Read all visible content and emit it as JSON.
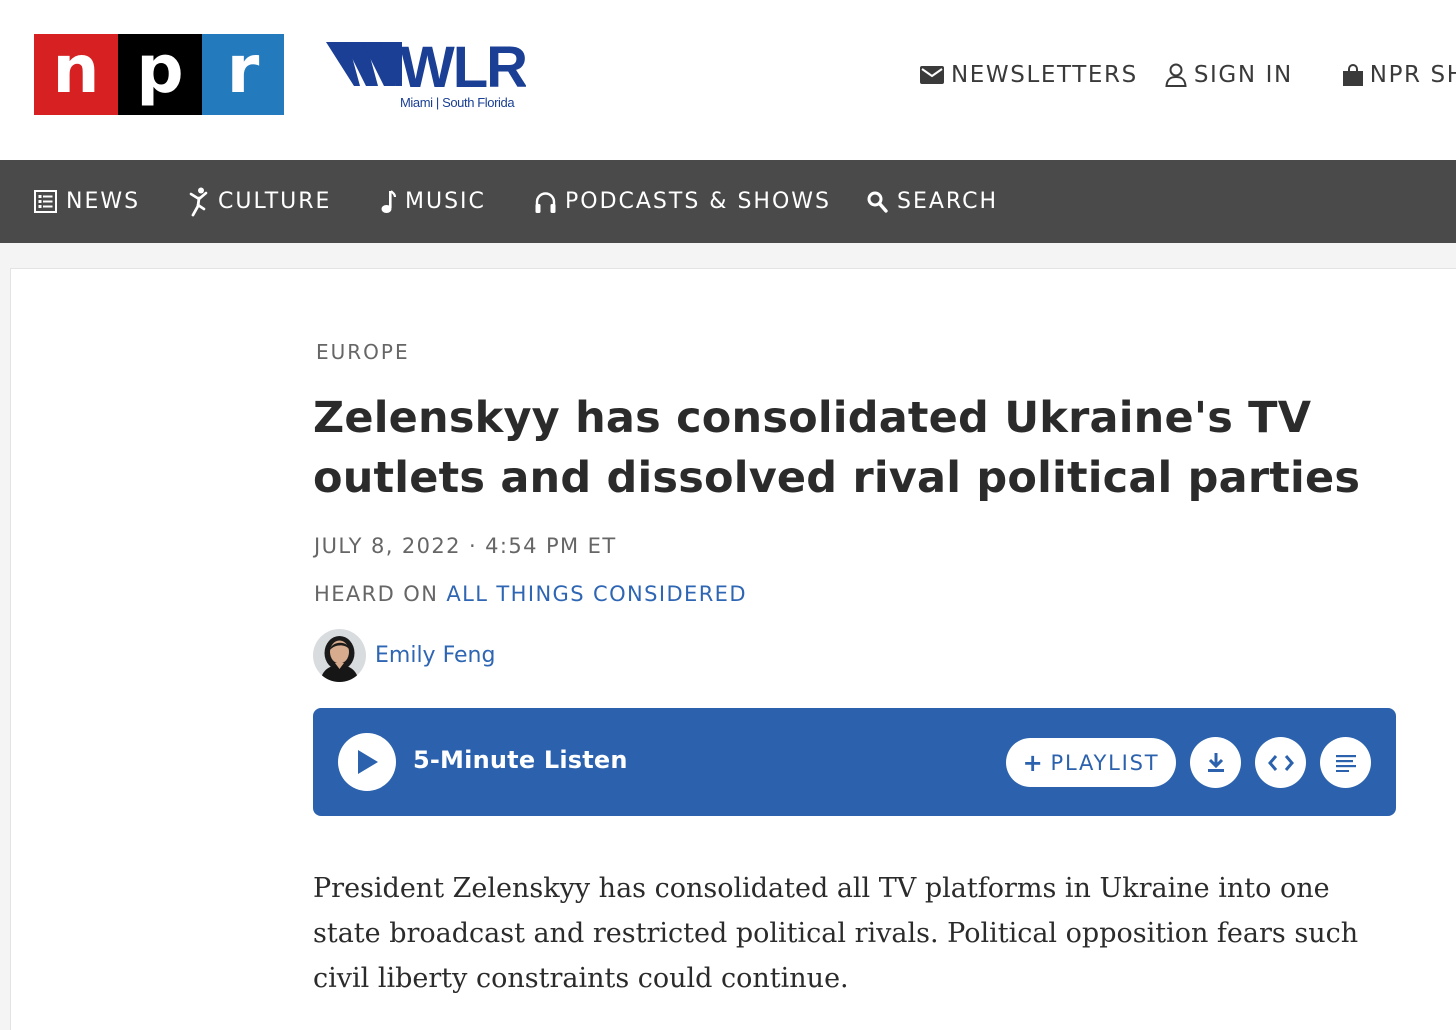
{
  "header": {
    "npr_letters": [
      "n",
      "p",
      "r"
    ],
    "station_name": "WLRN",
    "station_subtitle": "Miami | South Florida",
    "links": [
      {
        "label": "NEWSLETTERS",
        "icon": "envelope-icon"
      },
      {
        "label": "SIGN IN",
        "icon": "user-icon"
      },
      {
        "label": "NPR SHOP",
        "icon": "shopping-bag-icon"
      }
    ]
  },
  "nav": {
    "items": [
      {
        "label": "NEWS",
        "icon": "newspaper-icon"
      },
      {
        "label": "CULTURE",
        "icon": "dancer-icon"
      },
      {
        "label": "MUSIC",
        "icon": "music-note-icon"
      },
      {
        "label": "PODCASTS & SHOWS",
        "icon": "headphones-icon"
      },
      {
        "label": "SEARCH",
        "icon": "search-icon"
      }
    ]
  },
  "article": {
    "section": "EUROPE",
    "headline": "Zelenskyy has consolidated Ukraine's TV outlets and dissolved rival political parties",
    "dateline": "JULY 8, 2022 · 4:54 PM ET",
    "heard_on_label": "HEARD ON",
    "heard_on_show": "ALL THINGS CONSIDERED",
    "author": "Emily Feng",
    "teaser": "President Zelenskyy has consolidated all TV platforms in Ukraine into one state broadcast and restricted political rivals. Political opposition fears such civil liberty constraints could continue."
  },
  "player": {
    "listen_label": "5-Minute Listen",
    "playlist_label": "PLAYLIST",
    "buttons": [
      "play-icon",
      "download-icon",
      "embed-icon",
      "transcript-icon"
    ]
  },
  "colors": {
    "npr_red": "#d62021",
    "npr_black": "#000000",
    "npr_blue": "#237bbd",
    "nav_bg": "#4a4a4a",
    "player_bg": "#2c62ad",
    "link_blue": "#2f66b3",
    "wlrn_blue": "#1a3f95"
  }
}
